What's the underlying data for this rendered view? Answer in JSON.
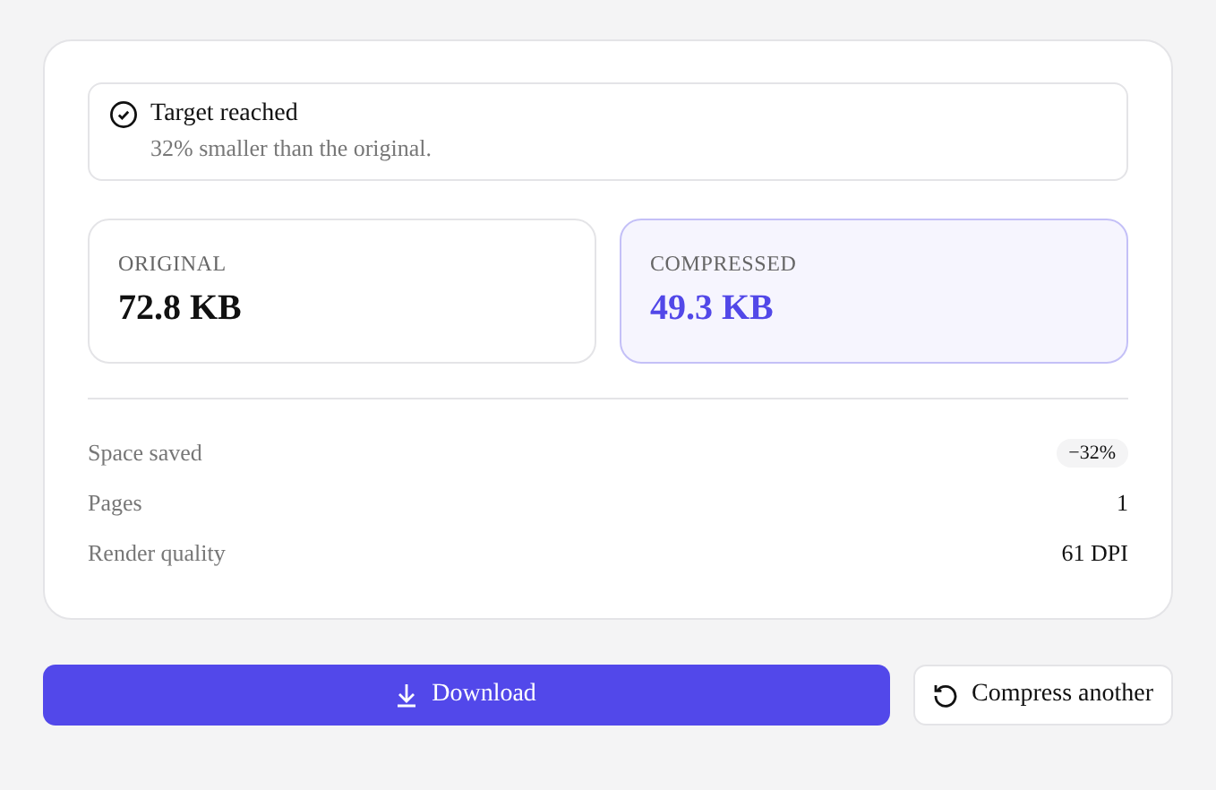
{
  "notice": {
    "title": "Target reached",
    "message": "32% smaller than the original."
  },
  "sizes": [
    {
      "label": "ORIGINAL",
      "value": "72.8 KB",
      "highlighted": false
    },
    {
      "label": "COMPRESSED",
      "value": "49.3 KB",
      "highlighted": true
    }
  ],
  "details": [
    {
      "label": "Space saved",
      "value": "−32%",
      "kind": "badge"
    },
    {
      "label": "Pages",
      "value": "1",
      "kind": "text"
    },
    {
      "label": "Render quality",
      "value": "61 DPI",
      "kind": "text"
    }
  ],
  "actions": [
    {
      "label": "Download",
      "kind": "primary"
    },
    {
      "label": "Compress another",
      "kind": "secondary"
    }
  ]
}
